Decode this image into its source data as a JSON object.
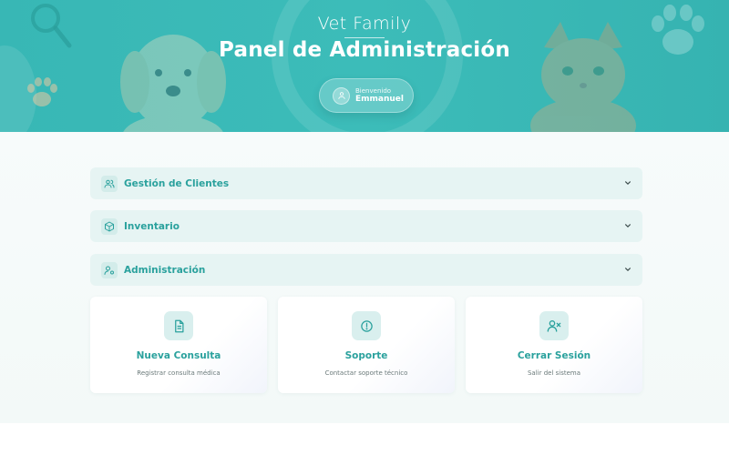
{
  "header": {
    "brand": "Vet Family",
    "title": "Panel de Administración",
    "welcome_label": "Bienvenido",
    "user_name": "Emmanuel"
  },
  "accordions": [
    {
      "label": "Gestión de Clientes",
      "icon": "users-icon"
    },
    {
      "label": "Inventario",
      "icon": "box-icon"
    },
    {
      "label": "Administración",
      "icon": "user-settings-icon"
    }
  ],
  "cards": [
    {
      "title": "Nueva Consulta",
      "subtitle": "Registrar consulta médica",
      "icon": "document-icon"
    },
    {
      "title": "Soporte",
      "subtitle": "Contactar soporte técnico",
      "icon": "alert-circle-icon"
    },
    {
      "title": "Cerrar Sesión",
      "subtitle": "Salir del sistema",
      "icon": "user-x-icon"
    }
  ],
  "colors": {
    "header_bg": "#3cbcb9",
    "accent": "#2aa19d",
    "accordion_bg": "#e6f4f3",
    "icon_bg": "#d9efee"
  }
}
